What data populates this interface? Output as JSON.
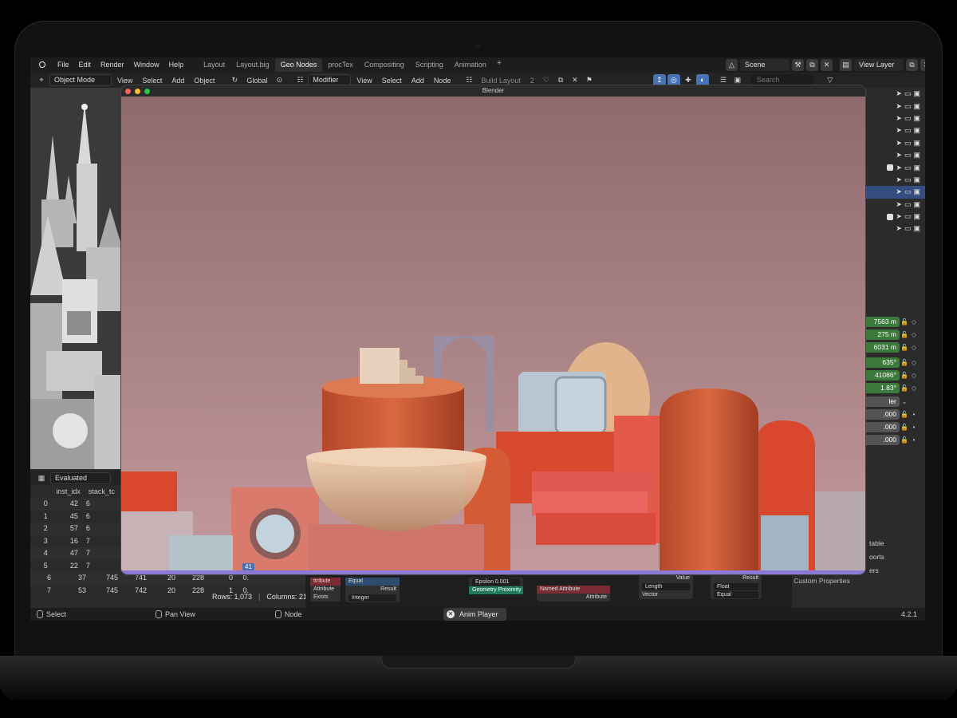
{
  "app": {
    "logo_icon": "blender-logo-icon",
    "menus": [
      "File",
      "Edit",
      "Render",
      "Window",
      "Help"
    ],
    "workspaces": [
      {
        "label": "Layout",
        "active": false
      },
      {
        "label": "Layout.big",
        "active": false
      },
      {
        "label": "Geo Nodes",
        "active": true
      },
      {
        "label": "procTex",
        "active": false
      },
      {
        "label": "Compositing",
        "active": false
      },
      {
        "label": "Scripting",
        "active": false
      },
      {
        "label": "Animation",
        "active": false
      }
    ],
    "add_workspace": "+",
    "scene": "Scene",
    "view_layer": "View Layer"
  },
  "header": {
    "mode": "Object Mode",
    "viewport_menus": [
      "View",
      "Select",
      "Add",
      "Object"
    ],
    "transform_orientation": "Global",
    "editor_type": "Modifier",
    "node_menus": [
      "View",
      "Select",
      "Add",
      "Node"
    ],
    "node_group": "Build Layout",
    "node_users": "2",
    "search_placeholder": "Search"
  },
  "render_window": {
    "title": "Blender",
    "frame": "41",
    "colors": {
      "sky_top": "#8f6a6c",
      "sky_bottom": "#c39a9d",
      "accent_orange": "#d8532f",
      "timeline": "#8a7ad6"
    }
  },
  "spreadsheet": {
    "mode": "Evaluated",
    "columns": [
      "inst_idx",
      "stack_tc"
    ],
    "rows": [
      {
        "idx": "0",
        "a": "42",
        "b": "6"
      },
      {
        "idx": "1",
        "a": "45",
        "b": "6"
      },
      {
        "idx": "2",
        "a": "57",
        "b": "6"
      },
      {
        "idx": "3",
        "a": "16",
        "b": "7"
      },
      {
        "idx": "4",
        "a": "47",
        "b": "7"
      },
      {
        "idx": "5",
        "a": "22",
        "b": "7"
      },
      {
        "idx": "6",
        "a": "37",
        "b": "745",
        "c": "741",
        "d": "20",
        "e": "228",
        "f": "0",
        "g": "0."
      },
      {
        "idx": "7",
        "a": "53",
        "b": "745",
        "c": "742",
        "d": "20",
        "e": "228",
        "f": "1",
        "g": "0."
      }
    ],
    "rows_label": "Rows: 1,073",
    "columns_label": "Columns: 21"
  },
  "properties": {
    "location": [
      "7563 m",
      "275 m",
      "6031 m"
    ],
    "rotation": [
      "635°",
      "41086°",
      "1.83°"
    ],
    "mode_label": "ler",
    "scale": [
      ".000",
      ".000",
      ".000"
    ],
    "labels": [
      "table",
      "oorts",
      "ers"
    ],
    "custom_properties": "Custom Properties"
  },
  "nodes": {
    "items": [
      {
        "title": "ttribute",
        "rows": [
          "Attribute",
          "Exists"
        ]
      },
      {
        "title": "Equal",
        "rows": [
          "Result",
          "Integer"
        ]
      },
      {
        "title": "Epsilon",
        "value": "0.001",
        "rows": [
          "Geometry Proximity"
        ]
      },
      {
        "title": "Named Attribute",
        "rows": [
          "Attribute"
        ]
      },
      {
        "title": "Value",
        "rows": [
          "Length",
          "Vector"
        ]
      },
      {
        "title": "Result",
        "rows": [
          "Float",
          "Equal"
        ]
      }
    ]
  },
  "statusbar": {
    "select": "Select",
    "pan": "Pan View",
    "node": "Node",
    "anim_player": "Anim Player",
    "version": "4.2.1"
  }
}
